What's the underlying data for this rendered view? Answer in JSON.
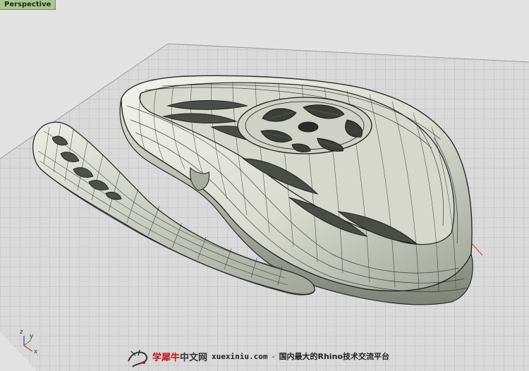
{
  "viewport": {
    "label": "Perspective"
  },
  "axes": {
    "z_label": "z",
    "y_label": "y",
    "x_label": "x"
  },
  "watermark": {
    "brand_red": "学犀牛",
    "brand_dark": "中文网",
    "url": "xuexiniu.com",
    "separator": "-",
    "tagline": "国内最大的Rhino技术交流平台"
  },
  "colors": {
    "viewport_bg": "#e2e2e2",
    "grid_line": "#bdbdbd",
    "grid_major": "#a6a6a6",
    "surface_light": "#e7e9df",
    "surface_mid": "#c9ccc0",
    "surface_dark": "#8f9488",
    "iso_line": "#2a2a2a",
    "tab_bg": "#a9c68f",
    "axis_x": "#d33",
    "axis_y": "#3a3",
    "axis_z": "#33c"
  }
}
